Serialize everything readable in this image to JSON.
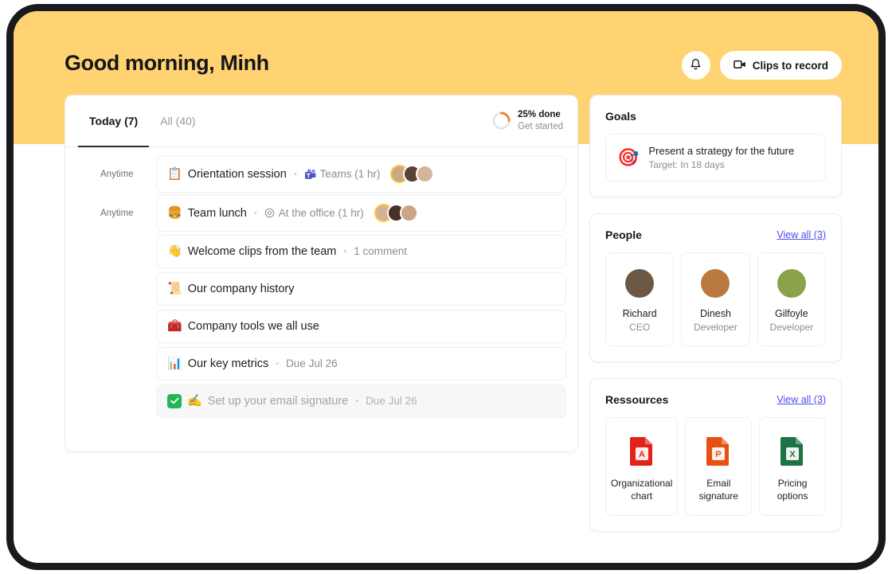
{
  "header": {
    "greeting": "Good morning, Minh",
    "bell_icon": "bell-icon",
    "clips_label": "Clips to record",
    "clips_icon": "video-camera-icon",
    "band_color": "#ffd371"
  },
  "tasks_panel": {
    "tabs": [
      {
        "label": "Today (7)",
        "active": true
      },
      {
        "label": "All (40)",
        "active": false
      }
    ],
    "progress": {
      "percent": 25,
      "primary": "25% done",
      "secondary": "Get started",
      "arc_color": "#f07c20",
      "track_color": "#e4e4e6"
    },
    "rows": [
      {
        "when": "Anytime",
        "emoji": "📋",
        "emoji_name": "clipboard-emoji",
        "title": "Orientation session",
        "separator": "•",
        "meta_icon": "teams-icon",
        "meta": "Teams (1 hr)",
        "avatars": [
          "#c9a98a",
          "#5b4035",
          "#d4b59a"
        ],
        "done": false
      },
      {
        "when": "Anytime",
        "emoji": "🍔",
        "emoji_name": "hamburger-emoji",
        "title": "Team lunch",
        "separator": "•",
        "meta_icon": "location-pin-icon",
        "meta": "At the office (1 hr)",
        "avatars": [
          "#d6b294",
          "#463028",
          "#c8a687"
        ],
        "done": false
      },
      {
        "when": "",
        "emoji": "👋",
        "emoji_name": "waving-hand-emoji",
        "title": "Welcome clips from the team",
        "separator": "•",
        "meta_icon": "",
        "meta": "1 comment",
        "avatars": [],
        "done": false
      },
      {
        "when": "",
        "emoji": "📜",
        "emoji_name": "scroll-emoji",
        "title": "Our company history",
        "separator": "",
        "meta_icon": "",
        "meta": "",
        "avatars": [],
        "done": false
      },
      {
        "when": "",
        "emoji": "🧰",
        "emoji_name": "toolbox-emoji",
        "title": "Company tools we all use",
        "separator": "",
        "meta_icon": "",
        "meta": "",
        "avatars": [],
        "done": false
      },
      {
        "when": "",
        "emoji": "📊",
        "emoji_name": "bar-chart-emoji",
        "title": "Our key metrics",
        "separator": "•",
        "meta_icon": "",
        "meta": "Due Jul 26",
        "avatars": [],
        "done": false
      },
      {
        "when": "",
        "emoji": "✍️",
        "emoji_name": "writing-hand-emoji",
        "title": "Set up your email signature",
        "separator": "•",
        "meta_icon": "",
        "meta": "Due Jul 26",
        "avatars": [],
        "done": true,
        "checkbox_color": "#23b556"
      }
    ]
  },
  "goals": {
    "title": "Goals",
    "items": [
      {
        "emoji": "🎯",
        "emoji_name": "dart-target-emoji",
        "title": "Present a strategy for the future",
        "subtitle": "Target: In 18 days"
      }
    ]
  },
  "people": {
    "title": "People",
    "view_all": "View all (3)",
    "items": [
      {
        "name": "Richard",
        "role": "CEO",
        "avatar_color": "#6b5744"
      },
      {
        "name": "Dinesh",
        "role": "Developer",
        "avatar_color": "#b9793f"
      },
      {
        "name": "Gilfoyle",
        "role": "Developer",
        "avatar_color": "#8aa24a"
      }
    ]
  },
  "resources": {
    "title": "Ressources",
    "view_all": "View all (3)",
    "items": [
      {
        "name": "Organizational chart",
        "file_type": "pdf",
        "icon": "pdf-file-icon",
        "color": "#e2231a"
      },
      {
        "name": "Email signature",
        "file_type": "pptx",
        "icon": "powerpoint-file-icon",
        "color": "#e8500f"
      },
      {
        "name": "Pricing options",
        "file_type": "xlsx",
        "icon": "excel-file-icon",
        "color": "#1f7244"
      }
    ]
  }
}
